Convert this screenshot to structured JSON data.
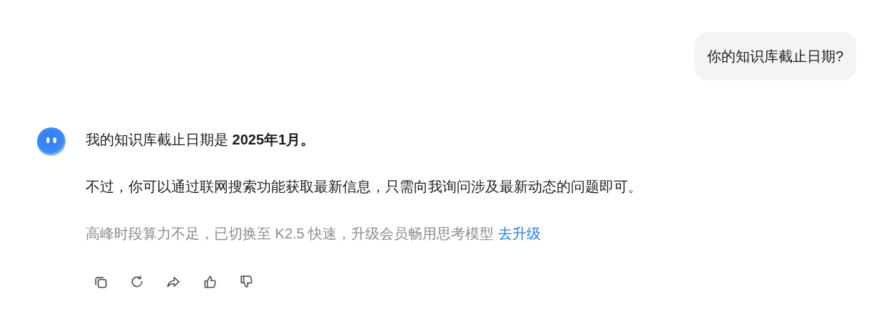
{
  "user_message": {
    "text": "你的知识库截止日期?"
  },
  "assistant_message": {
    "paragraphs": [
      "我的知识库截止日期是 **2025年1月。**",
      "不过，你可以通过联网搜索功能获取最新信息，只需向我询问涉及最新动态的问题即可。"
    ],
    "notice": {
      "text": "高峰时段算力不足，已切换至 K2.5 快速，升级会员畅用思考模型",
      "link": "去升级"
    },
    "actions": [
      {
        "kind": "copy"
      },
      {
        "kind": "retry"
      },
      {
        "kind": "share"
      },
      {
        "kind": "like"
      },
      {
        "kind": "dislike"
      }
    ]
  }
}
